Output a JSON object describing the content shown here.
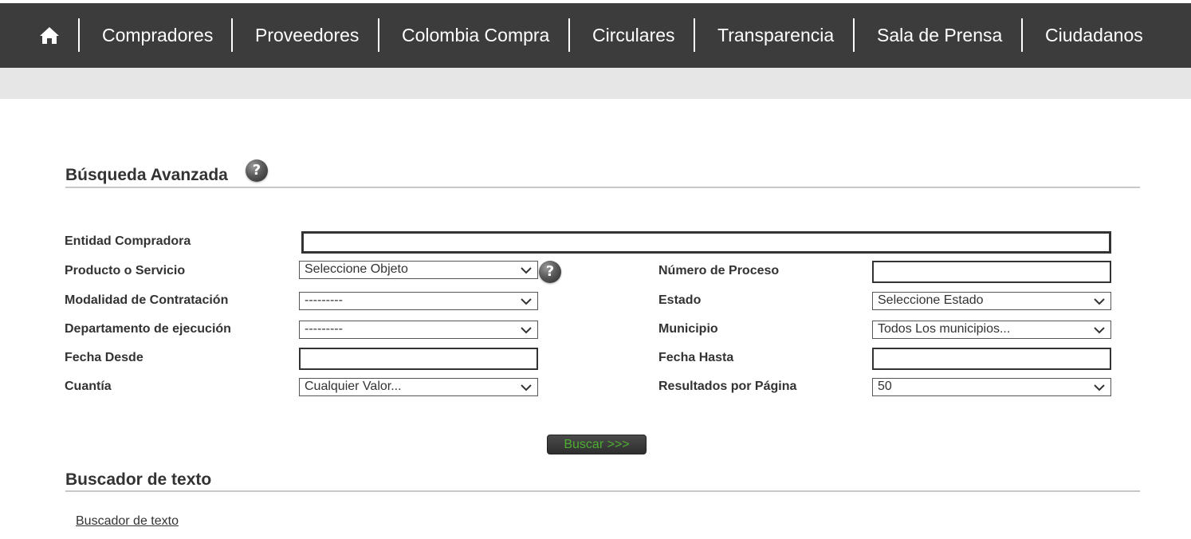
{
  "nav": {
    "home_icon": "home-icon",
    "items": [
      {
        "label": "Compradores"
      },
      {
        "label": "Proveedores"
      },
      {
        "label": "Colombia Compra"
      },
      {
        "label": "Circulares"
      },
      {
        "label": "Transparencia"
      },
      {
        "label": "Sala de Prensa"
      },
      {
        "label": "Ciudadanos"
      }
    ]
  },
  "advanced_search": {
    "title": "Búsqueda Avanzada",
    "help_icon": "help-icon",
    "fields": {
      "entidad": {
        "label": "Entidad Compradora",
        "value": ""
      },
      "producto": {
        "label": "Producto o Servicio",
        "value": "Seleccione Objeto"
      },
      "numero_proceso": {
        "label": "Número de Proceso",
        "value": ""
      },
      "modalidad": {
        "label": "Modalidad de Contratación",
        "value": "---------"
      },
      "estado": {
        "label": "Estado",
        "value": "Seleccione Estado"
      },
      "departamento": {
        "label": "Departamento de ejecución",
        "value": "---------"
      },
      "municipio": {
        "label": "Municipio",
        "value": "Todos Los municipios..."
      },
      "fecha_desde": {
        "label": "Fecha Desde",
        "value": ""
      },
      "fecha_hasta": {
        "label": "Fecha Hasta",
        "value": ""
      },
      "cuantia": {
        "label": "Cuantía",
        "value": "Cualquier Valor..."
      },
      "resultados": {
        "label": "Resultados por Página",
        "value": "50"
      }
    },
    "search_button": "Buscar >>>"
  },
  "text_search": {
    "title": "Buscador de texto",
    "link": "Buscador de texto"
  },
  "colors": {
    "navbar": "#3c3c3c",
    "subbar": "#e6e6e6",
    "button_text": "#4caf30"
  }
}
